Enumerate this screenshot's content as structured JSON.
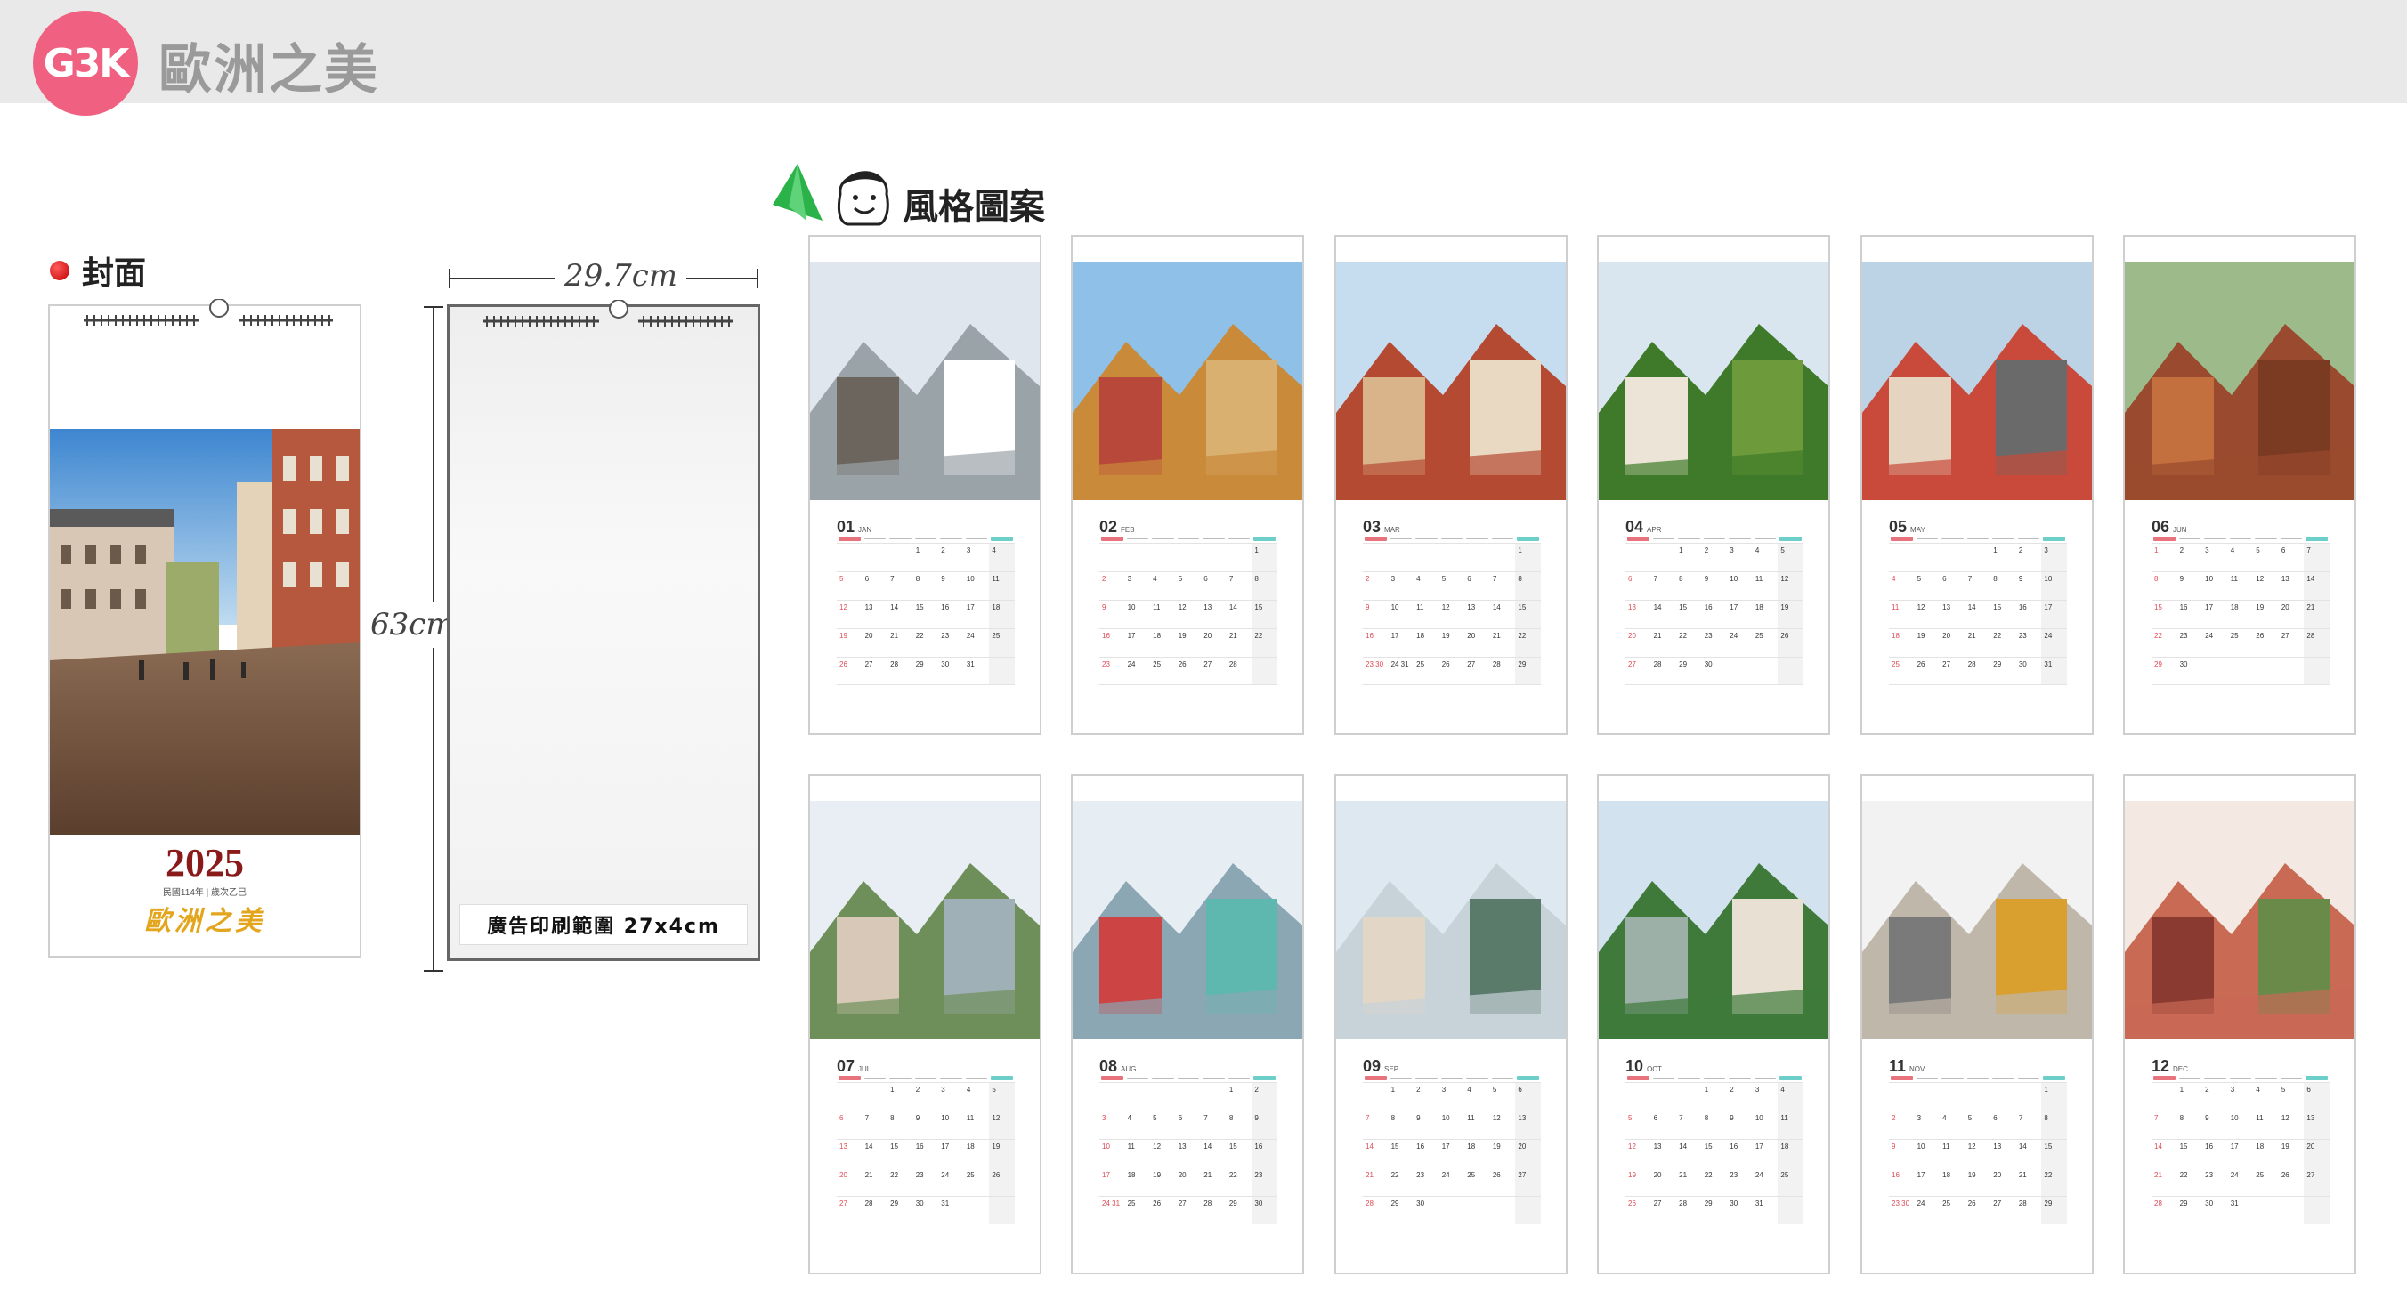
{
  "header": {
    "logo": "G3K",
    "title": "歐洲之美"
  },
  "cover": {
    "label": "封面",
    "year": "2025",
    "subtitle": "民國114年 | 歲次乙巳",
    "brand": "歐洲之美"
  },
  "template": {
    "width": "29.7cm",
    "height": "63cm",
    "ad_area": "廣告印刷範圍 27x4cm"
  },
  "styles": {
    "label": "風格圖案"
  },
  "months": [
    {
      "num": "01",
      "name": "JAN",
      "start": 3,
      "days": 31
    },
    {
      "num": "02",
      "name": "FEB",
      "start": 6,
      "days": 28
    },
    {
      "num": "03",
      "name": "MAR",
      "start": 6,
      "days": 31
    },
    {
      "num": "04",
      "name": "APR",
      "start": 2,
      "days": 30
    },
    {
      "num": "05",
      "name": "MAY",
      "start": 4,
      "days": 31
    },
    {
      "num": "06",
      "name": "JUN",
      "start": 0,
      "days": 30
    },
    {
      "num": "07",
      "name": "JUL",
      "start": 2,
      "days": 31
    },
    {
      "num": "08",
      "name": "AUG",
      "start": 5,
      "days": 31
    },
    {
      "num": "09",
      "name": "SEP",
      "start": 1,
      "days": 30
    },
    {
      "num": "10",
      "name": "OCT",
      "start": 3,
      "days": 31
    },
    {
      "num": "11",
      "name": "NOV",
      "start": 6,
      "days": 30
    },
    {
      "num": "12",
      "name": "DEC",
      "start": 1,
      "days": 31
    }
  ],
  "colors": {
    "sunday": "#e04a55",
    "saturday_header": "#6ccfc9",
    "logo": "#f06080",
    "cover_year": "#8a1a1a",
    "cover_brand": "#e3a51c"
  }
}
